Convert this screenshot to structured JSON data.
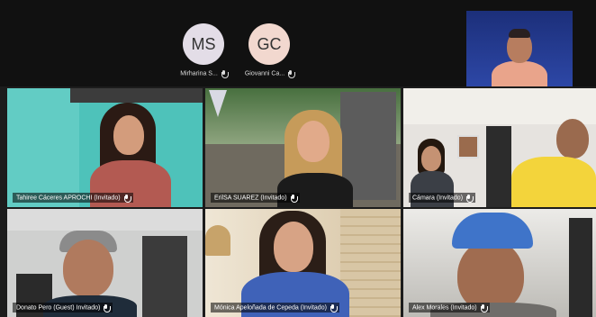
{
  "pinned_speaker": {
    "name": ""
  },
  "audio_only": [
    {
      "initials": "MS",
      "name": "Mirharina S..."
    },
    {
      "initials": "GC",
      "name": "Giovanni Ca..."
    }
  ],
  "tiles": [
    {
      "label": "Tahiree Cáceres APROCHI (Invitado)"
    },
    {
      "label": "ErilSA SUAREZ (Invitado)"
    },
    {
      "label": "Cámara (Invitado)"
    },
    {
      "label": "Donato Pero (Guest) Invitado)"
    },
    {
      "label": "Mónica Apeloñada de Cepeda (Invitado)"
    },
    {
      "label": "Alex Morales (Invitado)"
    }
  ],
  "colors": {
    "background": "#1c1c1c",
    "topbar": "#111111"
  }
}
